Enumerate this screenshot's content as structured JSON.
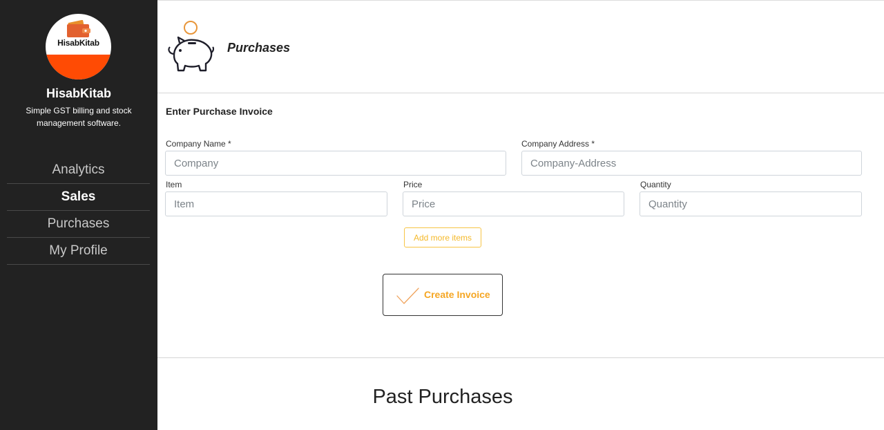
{
  "brand": {
    "logo_text": "HisabKitab",
    "name": "HisabKitab",
    "tagline": "Simple GST billing and stock management software."
  },
  "nav": {
    "items": [
      {
        "label": "Analytics"
      },
      {
        "label": "Sales"
      },
      {
        "label": "Purchases"
      },
      {
        "label": "My Profile"
      }
    ]
  },
  "header": {
    "title": "Purchases",
    "icon": "piggy-bank-icon"
  },
  "form": {
    "section_title": "Enter Purchase Invoice",
    "company_name": {
      "label": "Company Name *",
      "placeholder": "Company",
      "value": ""
    },
    "company_address": {
      "label": "Company Address *",
      "placeholder": "Company-Address",
      "value": ""
    },
    "item": {
      "label": "Item",
      "placeholder": "Item",
      "value": ""
    },
    "price": {
      "label": "Price",
      "placeholder": "Price",
      "value": ""
    },
    "quantity": {
      "label": "Quantity",
      "placeholder": "Quantity",
      "value": ""
    },
    "add_more_label": "Add more items",
    "create_label": "Create Invoice"
  },
  "past": {
    "title": "Past Purchases"
  },
  "colors": {
    "sidebar_bg": "#222222",
    "logo_accent": "#ff4b04",
    "button_accent": "#f5a623"
  }
}
